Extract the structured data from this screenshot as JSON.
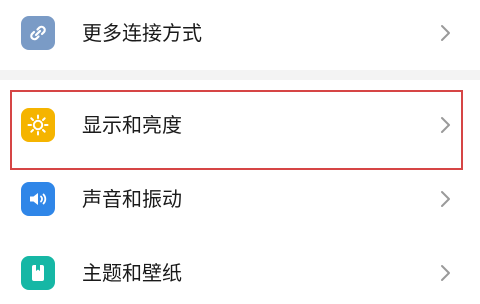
{
  "settings_list": {
    "items": [
      {
        "label": "更多连接方式",
        "icon": "link-icon",
        "icon_color": "#7a9bc6"
      },
      {
        "label": "显示和亮度",
        "icon": "sun-icon",
        "icon_color": "#f5b400",
        "highlighted": true
      },
      {
        "label": "声音和振动",
        "icon": "speaker-icon",
        "icon_color": "#2f86e8"
      },
      {
        "label": "主题和壁纸",
        "icon": "theme-card-icon",
        "icon_color": "#16b7a5"
      }
    ]
  },
  "colors": {
    "highlight_border": "#d64545",
    "chevron": "#9a9a9a",
    "separator": "#f3f3f3"
  }
}
